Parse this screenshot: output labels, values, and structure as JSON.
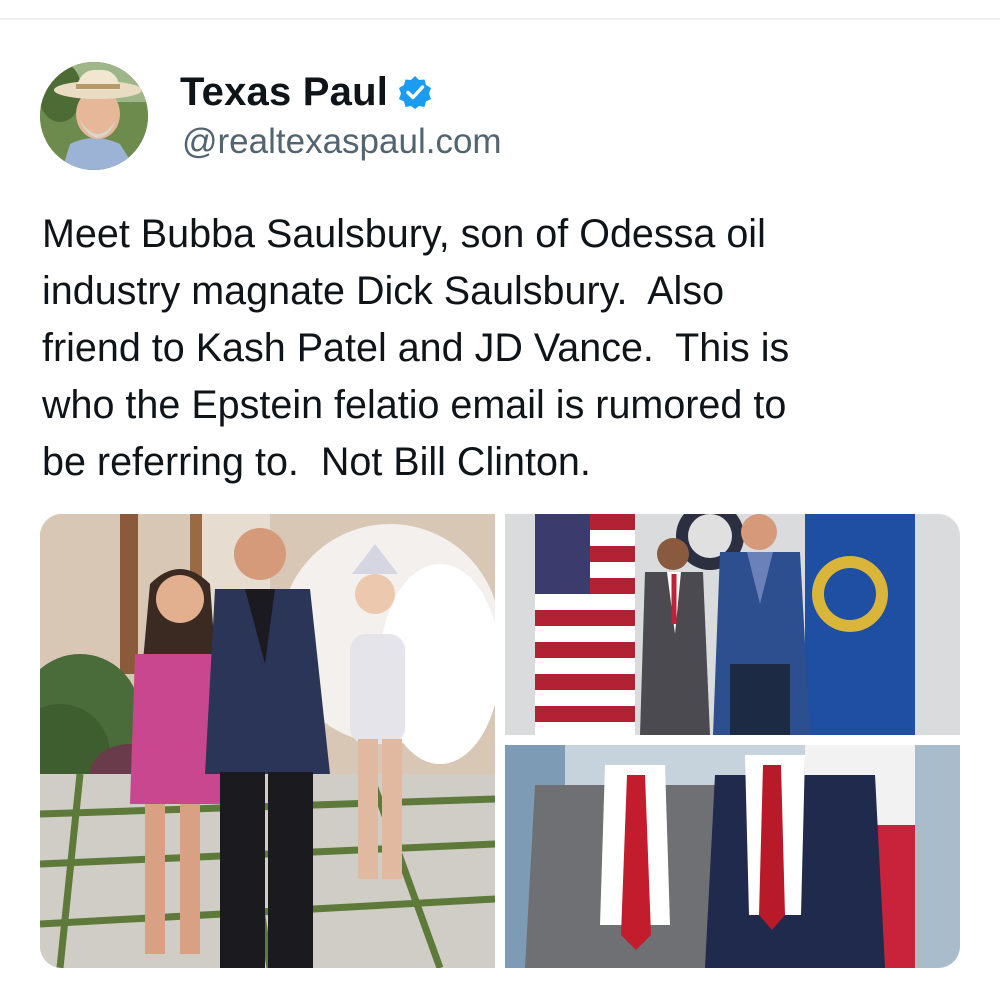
{
  "post": {
    "author": {
      "display_name": "Texas Paul",
      "handle": "@realtexaspaul.com",
      "verified": true,
      "verified_icon": "verified-badge-icon",
      "verified_color": "#1d9bf0"
    },
    "text": "Meet Bubba Saulsbury, son of Odessa oil\nindustry magnate Dick Saulsbury.  Also\nfriend to Kash Patel and JD Vance.  This is\nwho the Epstein felatio email is rumored to\nbe referring to.  Not Bill Clinton.",
    "media": [
      {
        "kind": "photo",
        "subject": "man in blue suit with woman in pink sequin dress and showgirl in feather costume"
      },
      {
        "kind": "photo",
        "subject": "two men standing between US flag and FBI flag"
      },
      {
        "kind": "photo",
        "subject": "two men in suits with red ties in front of flags"
      }
    ]
  }
}
